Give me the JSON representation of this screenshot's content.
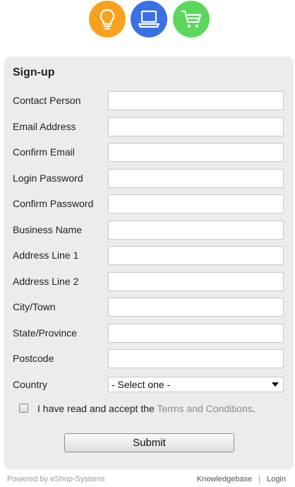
{
  "logos": [
    {
      "icon": "lightbulb-icon",
      "color": "#f8a21c"
    },
    {
      "icon": "laptop-icon",
      "color": "#3b6fe6"
    },
    {
      "icon": "shopping-cart-icon",
      "color": "#5bd85b"
    }
  ],
  "form": {
    "title": "Sign-up",
    "fields": [
      {
        "label": "Contact Person",
        "value": ""
      },
      {
        "label": "Email Address",
        "value": ""
      },
      {
        "label": "Confirm Email",
        "value": ""
      },
      {
        "label": "Login Password",
        "value": ""
      },
      {
        "label": "Confirm Password",
        "value": ""
      },
      {
        "label": "Business Name",
        "value": ""
      },
      {
        "label": "Address Line 1",
        "value": ""
      },
      {
        "label": "Address Line 2",
        "value": ""
      },
      {
        "label": "City/Town",
        "value": ""
      },
      {
        "label": "State/Province",
        "value": ""
      },
      {
        "label": "Postcode",
        "value": ""
      }
    ],
    "country": {
      "label": "Country",
      "selected": "- Select one -"
    },
    "terms": {
      "checked": false,
      "text": "I have read and accept the ",
      "link": "Terms and Conditions",
      "suffix": "."
    },
    "submit_label": "Submit"
  },
  "footer": {
    "powered_by": "Powered by eShop-Systems",
    "links": [
      "Knowledgebase",
      "Login"
    ],
    "separator": "|"
  },
  "colors": {
    "panel_bg": "#ececec",
    "link_gray": "#8c8c8c"
  }
}
